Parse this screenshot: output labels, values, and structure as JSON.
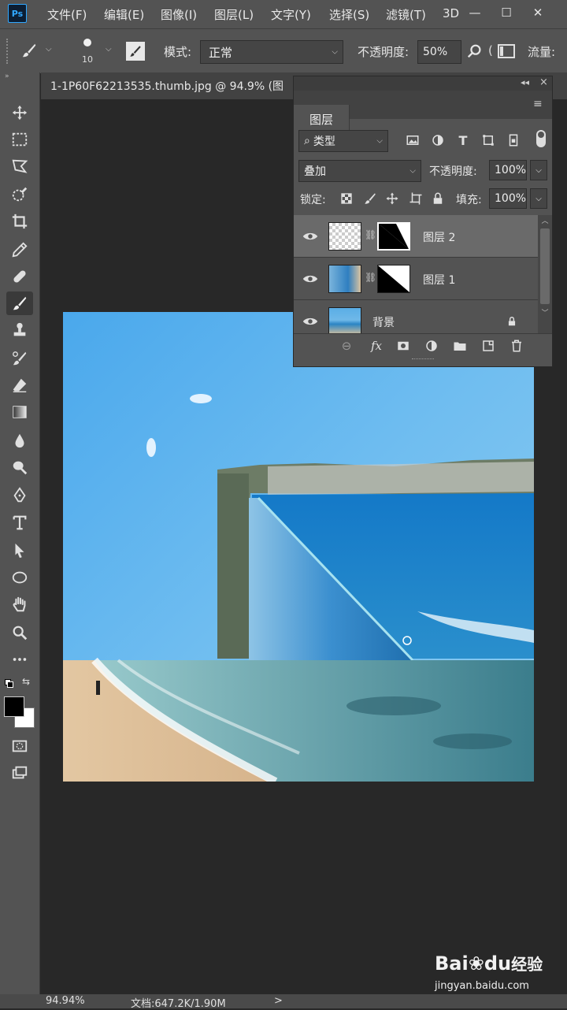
{
  "app": {
    "logo": "Ps"
  },
  "menu": [
    "文件(F)",
    "编辑(E)",
    "图像(I)",
    "图层(L)",
    "文字(Y)",
    "选择(S)",
    "滤镜(T)",
    "3D"
  ],
  "window_controls": {
    "minimize": "—",
    "restore": "☐",
    "close": "✕"
  },
  "options_bar": {
    "brush_size": "10",
    "mode_label": "模式:",
    "mode_value": "正常",
    "opacity_label": "不透明度:",
    "opacity_value": "50%",
    "flow_label": "流量:"
  },
  "document_tab": {
    "title": "1-1P60F62213535.thumb.jpg @ 94.9% (图"
  },
  "tools": [
    "move",
    "marquee",
    "lasso",
    "quick-select",
    "crop",
    "eyedropper",
    "healing",
    "brush",
    "stamp",
    "history-brush",
    "eraser",
    "gradient",
    "blur",
    "dodge",
    "pen",
    "type",
    "path-select",
    "ellipse",
    "hand",
    "zoom",
    "more"
  ],
  "layers_panel": {
    "tab": "图层",
    "filter_value": "类型",
    "blend_mode": "叠加",
    "opacity_label": "不透明度:",
    "opacity_value": "100%",
    "lock_label": "锁定:",
    "fill_label": "填充:",
    "fill_value": "100%",
    "layers": [
      {
        "name": "图层 2",
        "selected": true
      },
      {
        "name": "图层 1",
        "selected": false
      },
      {
        "name": "背景",
        "selected": false,
        "locked": true
      }
    ]
  },
  "status_bar": {
    "zoom": "94.94%",
    "doc_info": "文档:647.2K/1.90M",
    "arrow": ">"
  },
  "watermark": {
    "brand": "Bai",
    "brand2": "du",
    "cn": "经验",
    "url": "jingyan.baidu.com"
  },
  "colors": {
    "ui_dark": "#535353",
    "workspace": "#282828",
    "accent_blue": "#31a8ff"
  }
}
